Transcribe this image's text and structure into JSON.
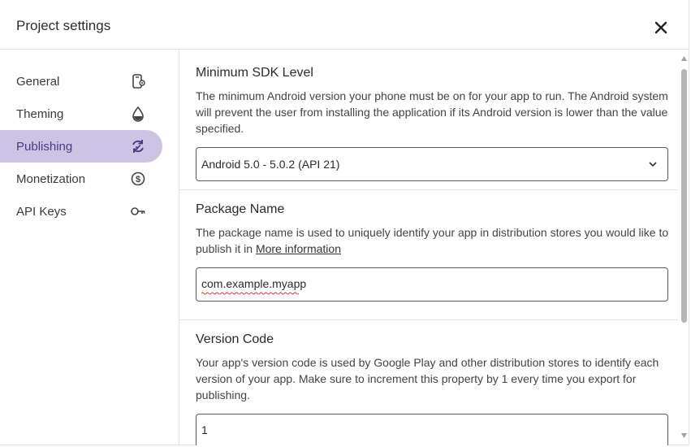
{
  "dialog": {
    "title": "Project settings",
    "close_icon": "close-icon"
  },
  "sidebar": {
    "items": [
      {
        "label": "General",
        "icon": "device-settings-icon",
        "active": false
      },
      {
        "label": "Theming",
        "icon": "droplet-icon",
        "active": false
      },
      {
        "label": "Publishing",
        "icon": "sync-icon",
        "active": true
      },
      {
        "label": "Monetization",
        "icon": "dollar-icon",
        "active": false
      },
      {
        "label": "API Keys",
        "icon": "key-icon",
        "active": false
      }
    ]
  },
  "sections": {
    "min_sdk": {
      "title": "Minimum SDK Level",
      "description": "The minimum Android version your phone must be on for your app to run. The Android system will prevent the user from installing the application if its Android version is lower than the value specified.",
      "selected_value": "Android 5.0 - 5.0.2 (API 21)"
    },
    "package_name": {
      "title": "Package Name",
      "description_prefix": "The package name is used to uniquely identify your app in distribution stores you would like to publish it in ",
      "link_text": "More information",
      "value": "com.example.myapp"
    },
    "version_code": {
      "title": "Version Code",
      "description": "Your app's version code is used by Google Play and other distribution stores to identify each version of your app. Make sure to increment this property by 1 every time you export for publishing.",
      "value": "1"
    }
  },
  "colors": {
    "active_nav_bg": "#cdc3e4",
    "active_nav_text": "#4a3a8a",
    "border": "#e2e2e2"
  }
}
